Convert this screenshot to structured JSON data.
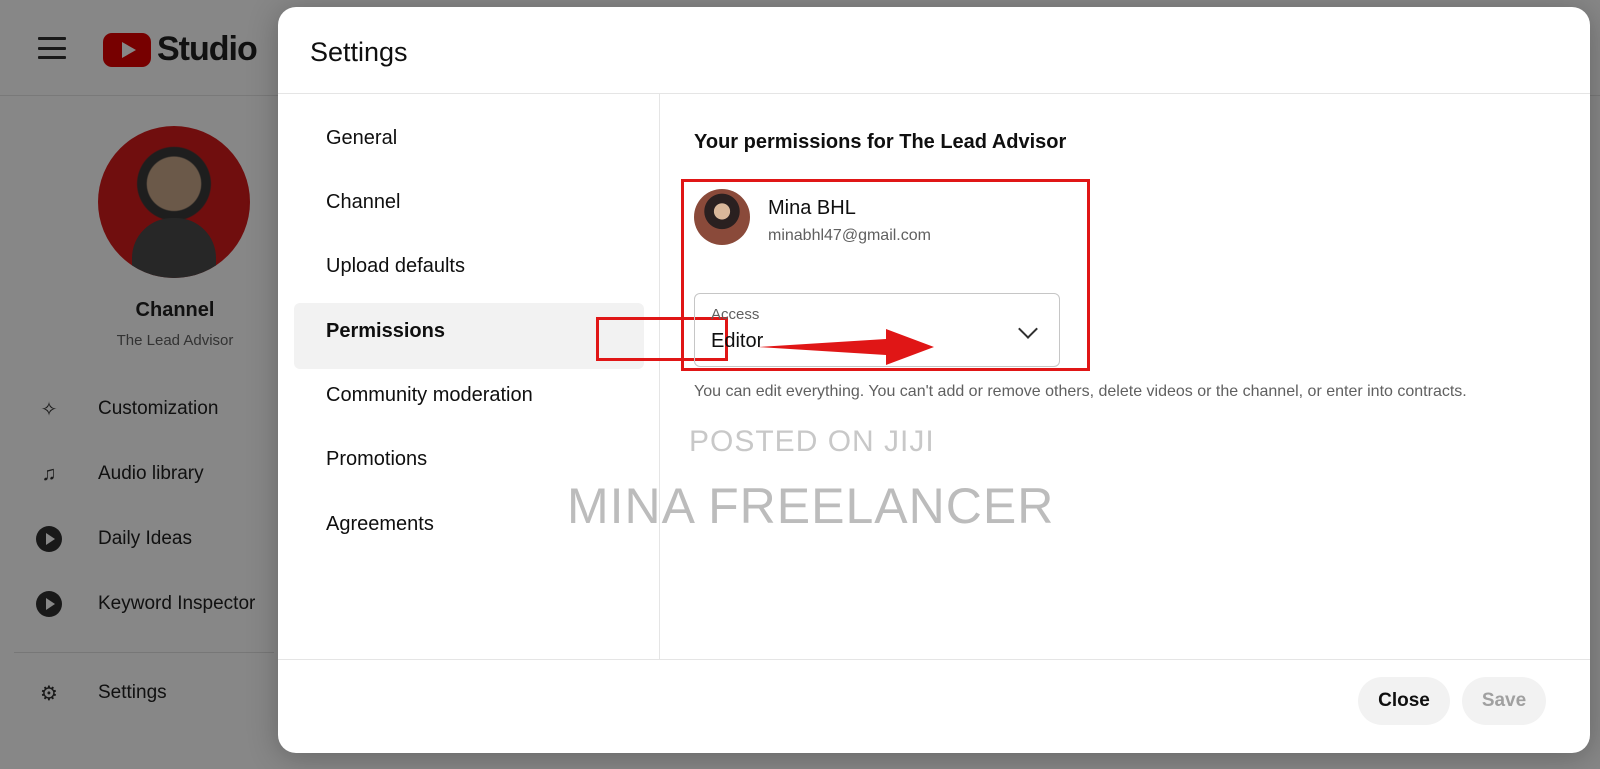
{
  "app": {
    "logo_text": "Studio",
    "channel_title": "Channel",
    "channel_name": "The Lead Advisor",
    "nav": [
      {
        "label": "Customization",
        "icon": "magic-wand-icon"
      },
      {
        "label": "Audio library",
        "icon": "audio-library-icon"
      },
      {
        "label": "Daily Ideas",
        "icon": "play-circle-icon"
      },
      {
        "label": "Keyword Inspector",
        "icon": "play-circle-icon"
      },
      {
        "label": "Settings",
        "icon": "gear-icon"
      }
    ]
  },
  "dialog": {
    "title": "Settings",
    "menu": [
      {
        "label": "General"
      },
      {
        "label": "Channel"
      },
      {
        "label": "Upload defaults"
      },
      {
        "label": "Permissions",
        "active": true
      },
      {
        "label": "Community moderation"
      },
      {
        "label": "Promotions"
      },
      {
        "label": "Agreements"
      }
    ],
    "permissions": {
      "heading": "Your permissions for The Lead Advisor",
      "user_name": "Mina BHL",
      "user_email": "minabhl47@gmail.com",
      "access_label": "Access",
      "access_value": "Editor",
      "access_description": "You can edit everything. You can't add or remove others, delete videos or the channel, or enter into contracts."
    },
    "buttons": {
      "close": "Close",
      "save": "Save"
    }
  },
  "watermarks": {
    "line1": "POSTED ON JIJI",
    "line2": "MINA FREELANCER"
  },
  "colors": {
    "highlight": "#e01616",
    "brand_red": "#e00000"
  }
}
